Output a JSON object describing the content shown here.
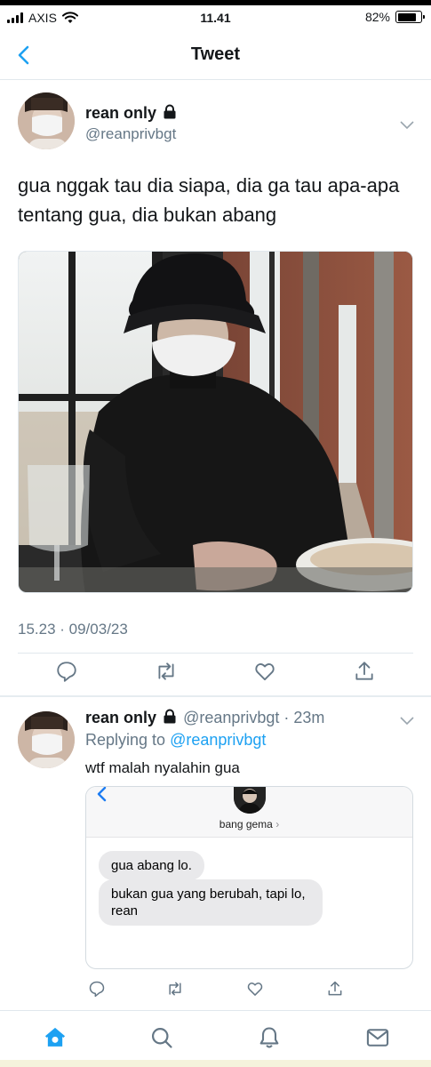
{
  "status_bar": {
    "carrier": "AXIS",
    "time": "11.41",
    "battery": "82%",
    "battery_level": 0.82
  },
  "nav": {
    "title": "Tweet"
  },
  "tweet": {
    "author_name": "rean only",
    "author_handle": "@reanprivbgt",
    "text": "gua nggak tau dia siapa, dia ga tau apa-apa tentang gua, dia bukan abang",
    "timestamp": "15.23 · 09/03/23"
  },
  "reply": {
    "author_name": "rean only",
    "author_handle": "@reanprivbgt",
    "age": "· 23m",
    "replying_prefix": "Replying to",
    "replying_to": "@reanprivbgt",
    "text": "wtf malah nyalahin gua",
    "screenshot": {
      "contact_name": "bang gema",
      "messages": [
        "gua abang lo.",
        "bukan gua yang berubah, tapi lo, rean"
      ]
    }
  },
  "icons": {
    "back": "chevron-left-icon",
    "lock": "lock-icon",
    "more": "chevron-down-icon",
    "actions": [
      "reply-icon",
      "retweet-icon",
      "like-icon",
      "share-icon"
    ],
    "tabs": [
      "home-icon",
      "search-icon",
      "notifications-icon",
      "messages-icon"
    ]
  },
  "colors": {
    "accent": "#1da1f2",
    "text": "#14171a",
    "secondary": "#657786",
    "divider": "#e1e8ed"
  }
}
